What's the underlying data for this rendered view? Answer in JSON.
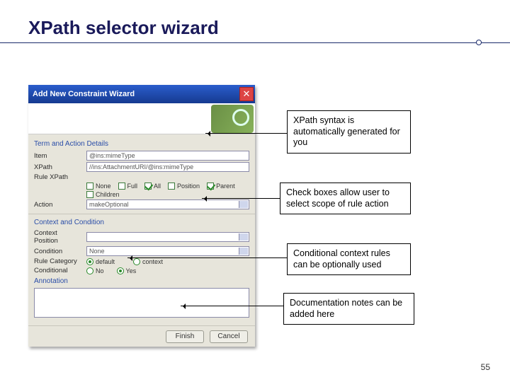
{
  "slide": {
    "title": "XPath selector wizard",
    "page_number": "55"
  },
  "callouts": {
    "c1": "XPath syntax is automatically generated for you",
    "c2": "Check boxes allow user to select scope of rule action",
    "c3": "Conditional context rules can be optionally used",
    "c4": "Documentation notes can be added here"
  },
  "wizard": {
    "window_title": "Add New Constraint Wizard",
    "close": "✕",
    "section_term": "Term and Action Details",
    "labels": {
      "item": "Item",
      "xpath": "XPath",
      "rule_xpath": "Rule XPath",
      "action": "Action",
      "context_position": "Context Position",
      "condition": "Condition",
      "rule_category": "Rule Category",
      "conditional": "Conditional",
      "annotation": "Annotation"
    },
    "values": {
      "item": "@ins:mimeType",
      "xpath": "//ins:AttachmentURI/@ins:mimeType",
      "action": "makeOptional",
      "condition": "None"
    },
    "checkboxes": {
      "none": "None",
      "full": "Full",
      "all": "All",
      "position": "Position",
      "parent": "Parent",
      "children": "Children"
    },
    "checked": {
      "all": true,
      "parent": true
    },
    "radios": {
      "default": "default",
      "context": "context"
    },
    "radio_selected": "default",
    "conditional": {
      "no": "No",
      "yes": "Yes",
      "selected": "yes"
    },
    "section_context": "Context and Condition",
    "buttons": {
      "finish": "Finish",
      "cancel": "Cancel"
    }
  }
}
